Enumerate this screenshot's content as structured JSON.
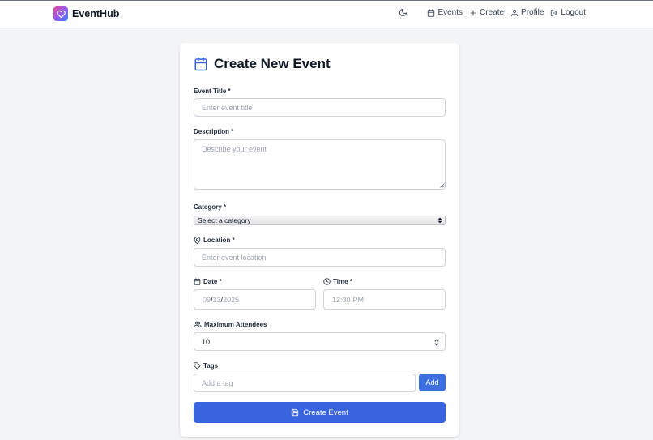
{
  "header": {
    "brand": "EventHub",
    "nav": {
      "events": "Events",
      "create": "Create",
      "profile": "Profile",
      "logout": "Logout"
    }
  },
  "form": {
    "title": "Create New Event",
    "event_title": {
      "label": "Event Title *",
      "placeholder": "Enter event title"
    },
    "description": {
      "label": "Description *",
      "placeholder": "Describe your event"
    },
    "category": {
      "label": "Category *",
      "selected": "Select a category"
    },
    "location": {
      "label": "Location *",
      "placeholder": "Enter event location"
    },
    "date": {
      "label": "Date *",
      "month": "09",
      "day": "13",
      "year": "2025",
      "separator": "/"
    },
    "time": {
      "label": "Time *",
      "hour": "12",
      "colon": ":",
      "minute": "30",
      "period": "PM"
    },
    "max_attendees": {
      "label": "Maximum Attendees",
      "value": "10"
    },
    "tags": {
      "label": "Tags",
      "placeholder": "Add a tag",
      "add_label": "Add"
    },
    "submit_label": "Create Event"
  },
  "colors": {
    "primary": "#3a63e0",
    "background": "#f3f4f6",
    "card": "#ffffff",
    "border": "#d1d5db"
  },
  "icons": [
    "heart-logo-icon",
    "moon-icon",
    "calendar-icon",
    "plus-icon",
    "user-icon",
    "logout-icon",
    "map-pin-icon",
    "clock-icon",
    "users-icon",
    "tag-icon",
    "save-icon"
  ]
}
